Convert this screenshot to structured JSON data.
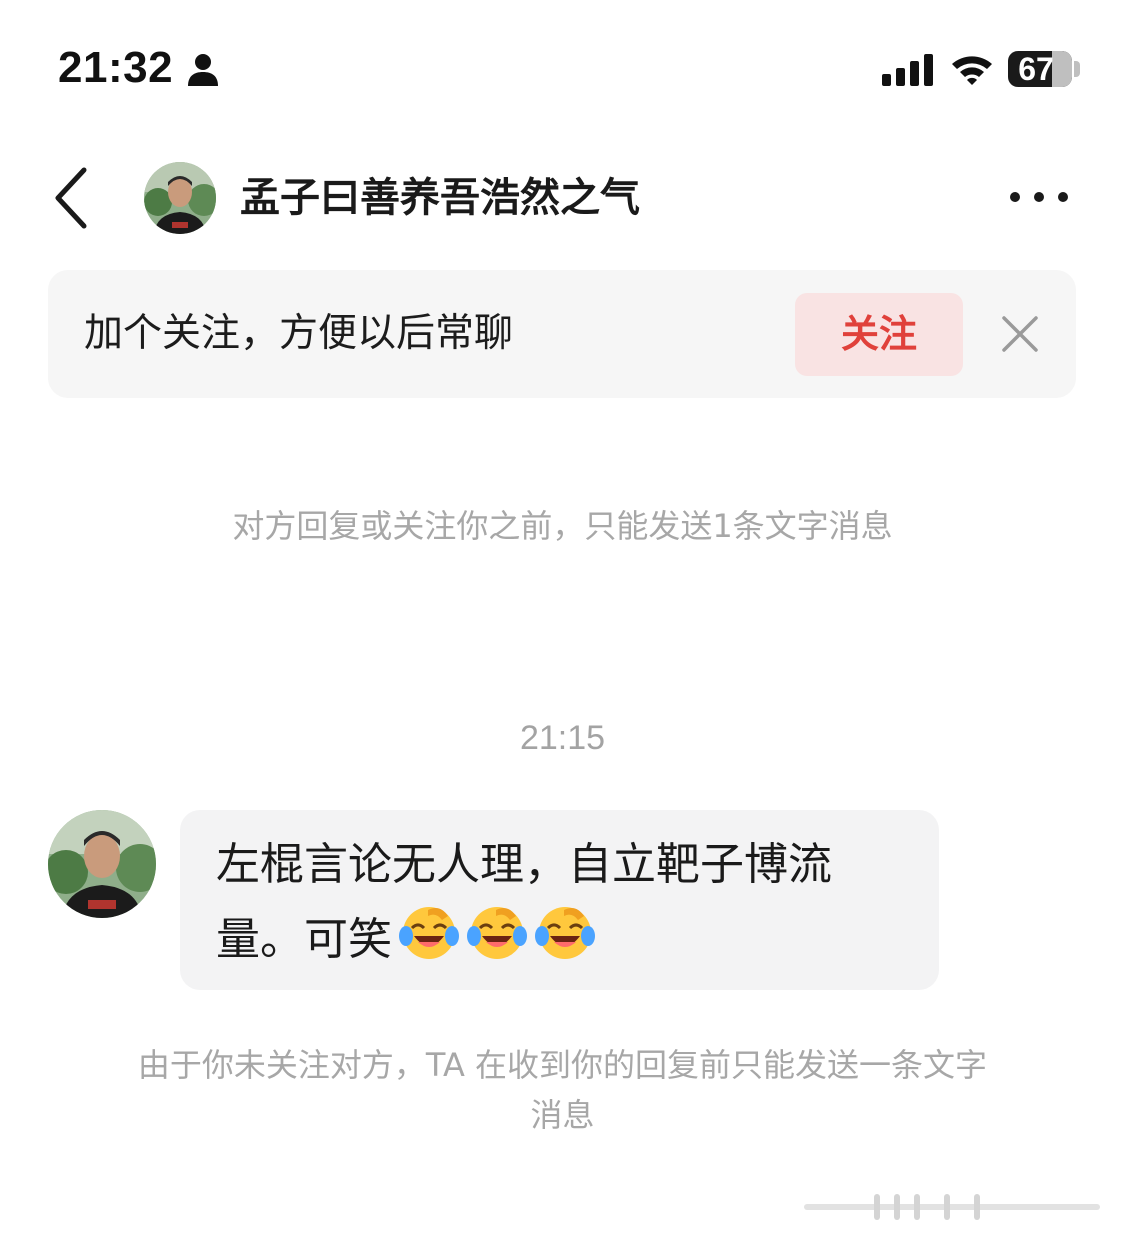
{
  "status_bar": {
    "time": "21:32",
    "battery": "67",
    "battery_level": 0.67
  },
  "header": {
    "title": "孟子曰善养吾浩然之气"
  },
  "follow_banner": {
    "text": "加个关注，方便以后常聊",
    "button_label": "关注"
  },
  "notice_top": "对方回复或关注你之前，只能发送1条文字消息",
  "timestamp": "21:15",
  "message": {
    "text": "左棍言论无人理，自立靶子博流量。可笑",
    "emoji_count": 3,
    "emoji_name": "laughing-crying-emoji"
  },
  "notice_bottom_line1": "由于你未关注对方，TA 在收到你的回复前只能发送一条文字",
  "notice_bottom_line2": "消息",
  "colors": {
    "accent_red": "#e0413b",
    "follow_button_bg": "#f9e3e3",
    "bubble_bg": "#f3f3f4",
    "muted_text": "#a7a7a7"
  }
}
